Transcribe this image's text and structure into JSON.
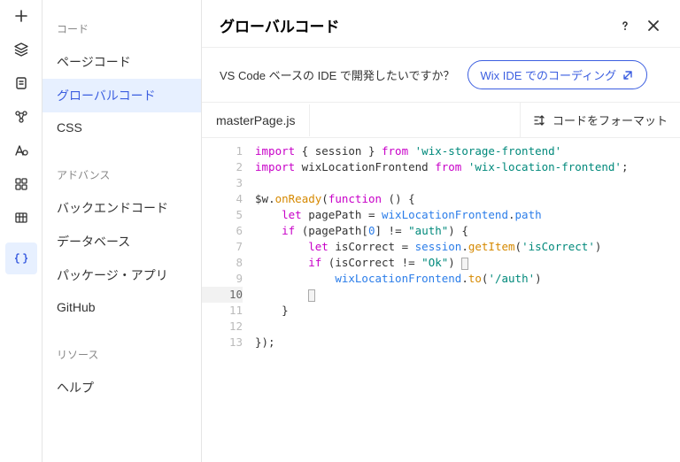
{
  "header": {
    "title": "グローバルコード"
  },
  "promo": {
    "text": "VS Code ベースの IDE で開発したいですか？",
    "link": "Wix IDE でのコーディング"
  },
  "tabs": {
    "file": "masterPage.js",
    "format": "コードをフォーマット"
  },
  "sidebar": {
    "sections": [
      {
        "title": "コード",
        "items": [
          "ページコード",
          "グローバルコード",
          "CSS"
        ],
        "active": 1
      },
      {
        "title": "アドバンス",
        "items": [
          "バックエンドコード",
          "データベース",
          "パッケージ・アプリ",
          "GitHub"
        ]
      },
      {
        "title": "リソース",
        "items": [
          "ヘルプ"
        ]
      }
    ]
  },
  "code": {
    "lines": [
      [
        {
          "t": "import",
          "c": "kw"
        },
        {
          "t": " { session } "
        },
        {
          "t": "from",
          "c": "kw"
        },
        {
          "t": " "
        },
        {
          "t": "'wix-storage-frontend'",
          "c": "str"
        }
      ],
      [
        {
          "t": "import",
          "c": "kw"
        },
        {
          "t": " wixLocationFrontend "
        },
        {
          "t": "from",
          "c": "kw"
        },
        {
          "t": " "
        },
        {
          "t": "'wix-location-frontend'",
          "c": "str"
        },
        {
          "t": ";"
        }
      ],
      [],
      [
        {
          "t": "$w"
        },
        {
          "t": ".",
          "c": "ident"
        },
        {
          "t": "onReady",
          "c": "fn"
        },
        {
          "t": "("
        },
        {
          "t": "function",
          "c": "kw"
        },
        {
          "t": " () {"
        }
      ],
      [
        {
          "t": "    "
        },
        {
          "t": "let",
          "c": "kw"
        },
        {
          "t": " pagePath = "
        },
        {
          "t": "wixLocationFrontend",
          "c": "var2"
        },
        {
          "t": "."
        },
        {
          "t": "path",
          "c": "var2"
        }
      ],
      [
        {
          "t": "    "
        },
        {
          "t": "if",
          "c": "kw"
        },
        {
          "t": " (pagePath["
        },
        {
          "t": "0",
          "c": "num"
        },
        {
          "t": "] != "
        },
        {
          "t": "\"auth\"",
          "c": "str"
        },
        {
          "t": ") {"
        }
      ],
      [
        {
          "t": "        "
        },
        {
          "t": "let",
          "c": "kw"
        },
        {
          "t": " isCorrect = "
        },
        {
          "t": "session",
          "c": "var2"
        },
        {
          "t": "."
        },
        {
          "t": "getItem",
          "c": "fn"
        },
        {
          "t": "("
        },
        {
          "t": "'isCorrect'",
          "c": "str"
        },
        {
          "t": ")"
        }
      ],
      [
        {
          "t": "        "
        },
        {
          "t": "if",
          "c": "kw"
        },
        {
          "t": " (isCorrect != "
        },
        {
          "t": "\"Ok\"",
          "c": "str"
        },
        {
          "t": ") "
        },
        {
          "cursor": true
        }
      ],
      [
        {
          "t": "            "
        },
        {
          "t": "wixLocationFrontend",
          "c": "var2"
        },
        {
          "t": "."
        },
        {
          "t": "to",
          "c": "fn"
        },
        {
          "t": "("
        },
        {
          "t": "'/auth'",
          "c": "str"
        },
        {
          "t": ")"
        }
      ],
      [
        {
          "t": "        "
        },
        {
          "cursor": true
        }
      ],
      [
        {
          "t": "    }"
        }
      ],
      [],
      [
        {
          "t": "});"
        }
      ]
    ],
    "selected_line": 10
  }
}
